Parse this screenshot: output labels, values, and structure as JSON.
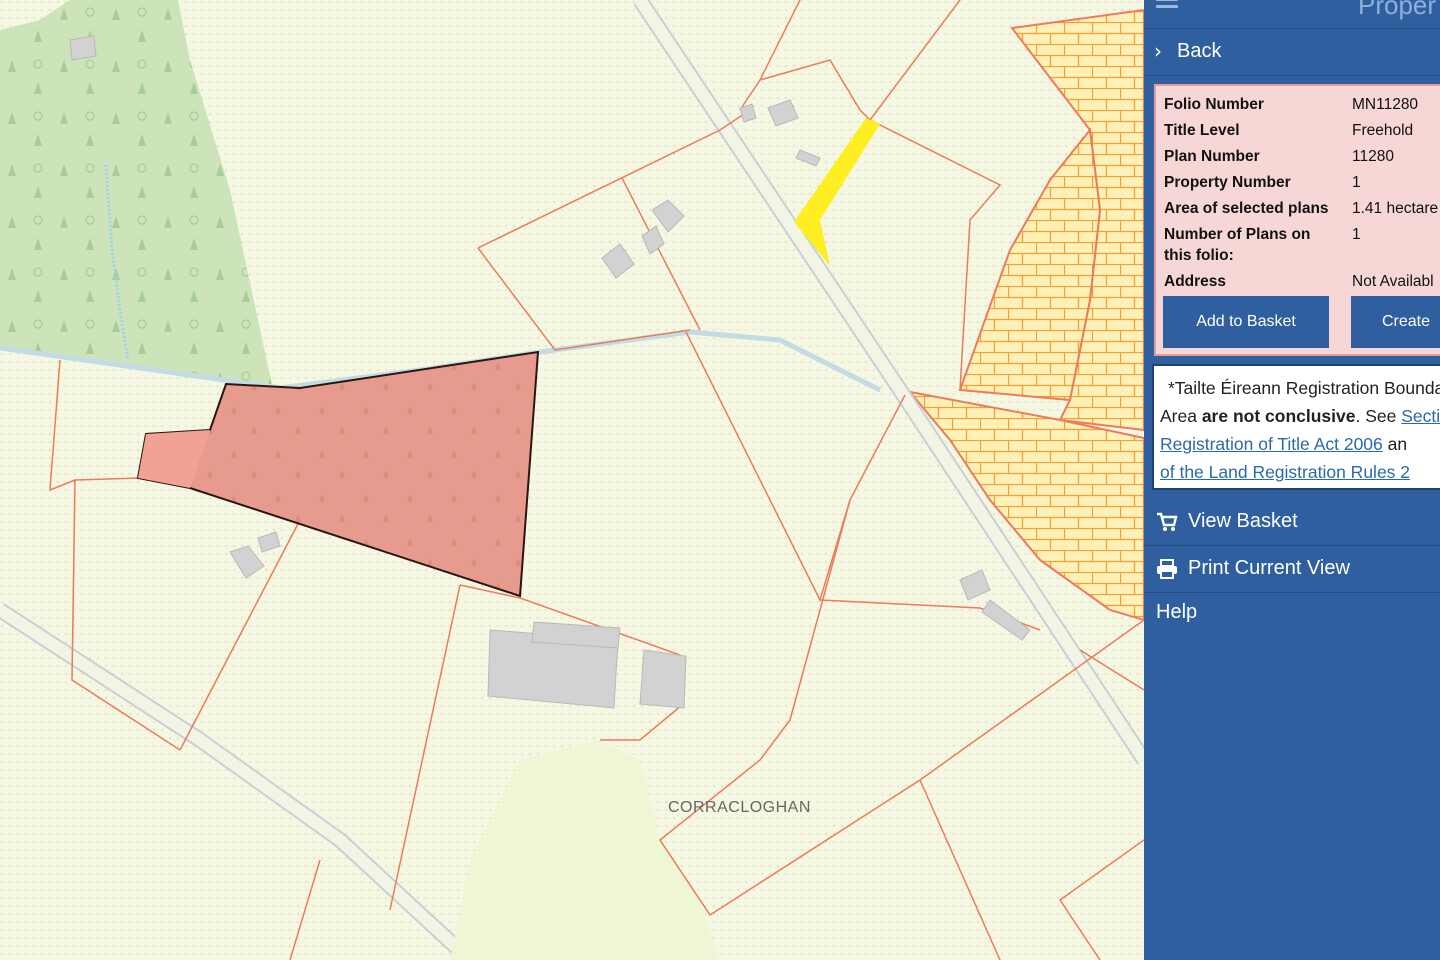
{
  "map": {
    "place_label": "CORRACLOGHAN",
    "colors": {
      "background": "#f4f7e2",
      "forest": "#cfe6bd",
      "boundary": "#ec7b5b",
      "selected_fill": "#e8938a",
      "highlight": "#ffee22",
      "hatch": "#f6a23a",
      "road": "#c8d0d6"
    }
  },
  "panel": {
    "title": "Proper",
    "back_label": "Back",
    "details": [
      {
        "key": "Folio Number",
        "value": "MN11280"
      },
      {
        "key": "Title Level",
        "value": "Freehold"
      },
      {
        "key": "Plan Number",
        "value": "11280"
      },
      {
        "key": "Property Number",
        "value": "1"
      },
      {
        "key": "Area of selected plans",
        "value": "1.41 hectare"
      },
      {
        "key": "Number of Plans on",
        "key2": "this folio:",
        "value": "1"
      },
      {
        "key": "Address",
        "value": "Not Availabl"
      }
    ],
    "add_to_basket": "Add to Basket",
    "create": "Create",
    "notice": {
      "line1": "*Tailte Éireann Registration Bounda",
      "line2_a": "Area ",
      "line2_b": "are not conclusive",
      "line2_c": ". See ",
      "line2_link": "Sectio",
      "line3_link": "Registration of Title Act 2006",
      "line3_rest": " an",
      "line4_link": "of the Land Registration Rules 2"
    },
    "menu": {
      "view_basket": "View Basket",
      "print": "Print Current View",
      "help": "Help"
    }
  }
}
